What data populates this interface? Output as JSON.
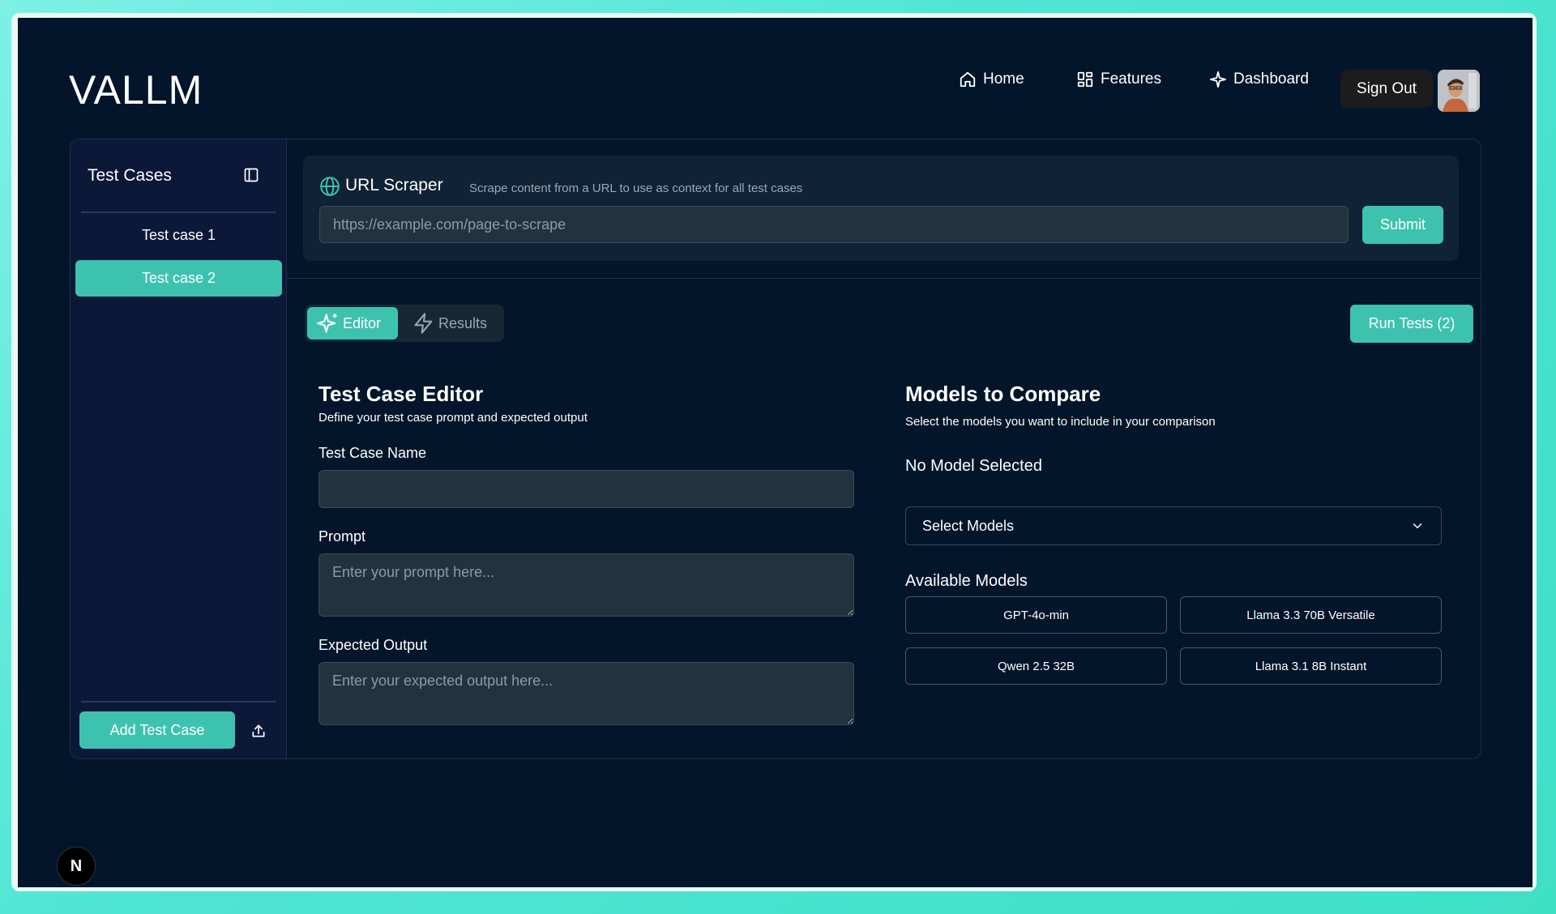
{
  "app": {
    "title": "VALLM"
  },
  "nav": {
    "home": "Home",
    "features": "Features",
    "dashboard": "Dashboard",
    "sign_out": "Sign Out"
  },
  "sidebar": {
    "title": "Test Cases",
    "items": [
      {
        "label": "Test case 1",
        "active": false
      },
      {
        "label": "Test case 2",
        "active": true
      }
    ],
    "add_label": "Add Test Case"
  },
  "scraper": {
    "title": "URL Scraper",
    "description": "Scrape content from a URL to use as context for all test cases",
    "placeholder": "https://example.com/page-to-scrape",
    "submit_label": "Submit"
  },
  "tabs": [
    {
      "label": "Editor",
      "active": true,
      "icon": "sparkles-icon"
    },
    {
      "label": "Results",
      "active": false,
      "icon": "zap-icon"
    }
  ],
  "run_tests_label": "Run Tests (2)",
  "editor": {
    "title": "Test Case Editor",
    "subtitle": "Define your test case prompt and expected output",
    "name_label": "Test Case Name",
    "name_value": "",
    "prompt_label": "Prompt",
    "prompt_placeholder": "Enter your prompt here...",
    "output_label": "Expected Output",
    "output_placeholder": "Enter your expected output here..."
  },
  "models": {
    "title": "Models to Compare",
    "subtitle": "Select the models you want to include in your comparison",
    "status": "No Model Selected",
    "select_label": "Select Models",
    "available_label": "Available Models",
    "available": [
      "GPT-4o-min",
      "Llama 3.3 70B Versatile",
      "Qwen 2.5 32B",
      "Llama 3.1 8B Instant"
    ]
  },
  "badge": "N",
  "colors": {
    "accent": "#3ec2b0",
    "background": "#03152a",
    "sidebar": "#0c1838",
    "input": "#22333f"
  }
}
